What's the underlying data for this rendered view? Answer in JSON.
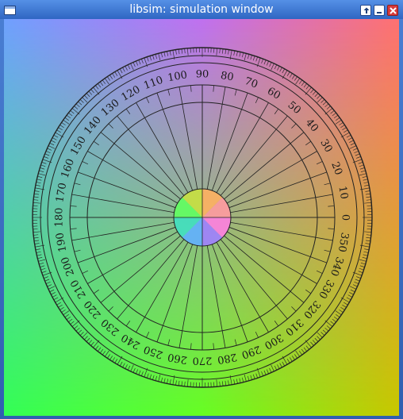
{
  "window": {
    "title": "libsim: simulation window"
  },
  "titlebar_buttons": {
    "restore": "restore-icon",
    "minimize": "minimize-icon",
    "close": "close-icon"
  },
  "colors": {
    "titlebar": "#2f66c2",
    "close_button": "#d83a3a",
    "corner_top_left": "#6fa0ff",
    "corner_top_right": "#ff7070",
    "corner_bottom_left": "#33ff55",
    "corner_bottom_right": "#c8c800"
  },
  "protractor": {
    "labels": [
      "0",
      "10",
      "20",
      "30",
      "40",
      "50",
      "60",
      "70",
      "80",
      "90",
      "100",
      "110",
      "120",
      "130",
      "140",
      "150",
      "160",
      "170",
      "180",
      "190",
      "200",
      "210",
      "220",
      "230",
      "240",
      "250",
      "260",
      "270",
      "280",
      "290",
      "300",
      "310",
      "320",
      "330",
      "340",
      "350"
    ]
  }
}
